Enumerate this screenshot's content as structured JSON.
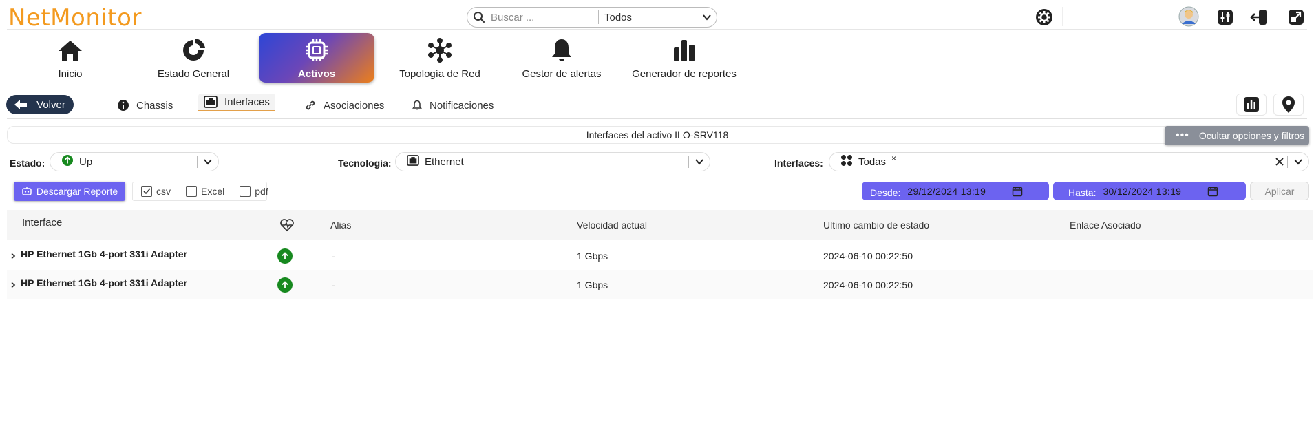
{
  "app": {
    "logo_text": "NetMonitor"
  },
  "search": {
    "placeholder": "Buscar ...",
    "scope": "Todos"
  },
  "nav": [
    {
      "label": "Inicio",
      "icon": "home-icon"
    },
    {
      "label": "Estado General",
      "icon": "donut-chart-icon"
    },
    {
      "label": "Activos",
      "icon": "chip-icon",
      "active": true
    },
    {
      "label": "Topología de Red",
      "icon": "network-topology-icon"
    },
    {
      "label": "Gestor de alertas",
      "icon": "bell-icon"
    },
    {
      "label": "Generador de reportes",
      "icon": "bar-chart-icon"
    }
  ],
  "subnav": {
    "back_label": "Volver",
    "tabs": [
      {
        "label": "Chassis",
        "icon": "info-icon"
      },
      {
        "label": "Interfaces",
        "icon": "ethernet-port-icon",
        "active": true
      },
      {
        "label": "Asociaciones",
        "icon": "link-icon"
      },
      {
        "label": "Notificaciones",
        "icon": "bell-icon"
      }
    ]
  },
  "panel": {
    "title": "Interfaces del activo ILO-SRV118",
    "toggle_label": "Ocultar opciones y filtros"
  },
  "filters": {
    "estado": {
      "label": "Estado:",
      "value": "Up"
    },
    "tecnologia": {
      "label": "Tecnología:",
      "value": "Ethernet"
    },
    "interfaces": {
      "label": "Interfaces:",
      "value": "Todas",
      "remove": "×"
    }
  },
  "report": {
    "download_label": "Descargar Reporte",
    "formats": [
      {
        "label": "csv",
        "checked": true
      },
      {
        "label": "Excel",
        "checked": false
      },
      {
        "label": "pdf",
        "checked": false
      }
    ],
    "desde_label": "Desde:",
    "desde_value": "29/12/2024 13:19",
    "hasta_label": "Hasta:",
    "hasta_value": "30/12/2024 13:19",
    "apply_label": "Aplicar"
  },
  "table": {
    "headers": {
      "interface": "Interface",
      "alias": "Alias",
      "speed": "Velocidad actual",
      "last_change": "Ultimo cambio de estado",
      "link": "Enlace Asociado"
    },
    "rows": [
      {
        "interface": "HP Ethernet 1Gb 4-port 331i Adapter",
        "status": "up",
        "alias": "-",
        "speed": "1 Gbps",
        "last_change": "2024-06-10 00:22:50",
        "link": ""
      },
      {
        "interface": "HP Ethernet 1Gb 4-port 331i Adapter",
        "status": "up",
        "alias": "-",
        "speed": "1 Gbps",
        "last_change": "2024-06-10 00:22:50",
        "link": ""
      }
    ]
  },
  "colors": {
    "brand_orange": "#f39a1f",
    "accent_purple": "#6c63f0",
    "dark_navy": "#24344d",
    "status_green": "#17891f"
  }
}
